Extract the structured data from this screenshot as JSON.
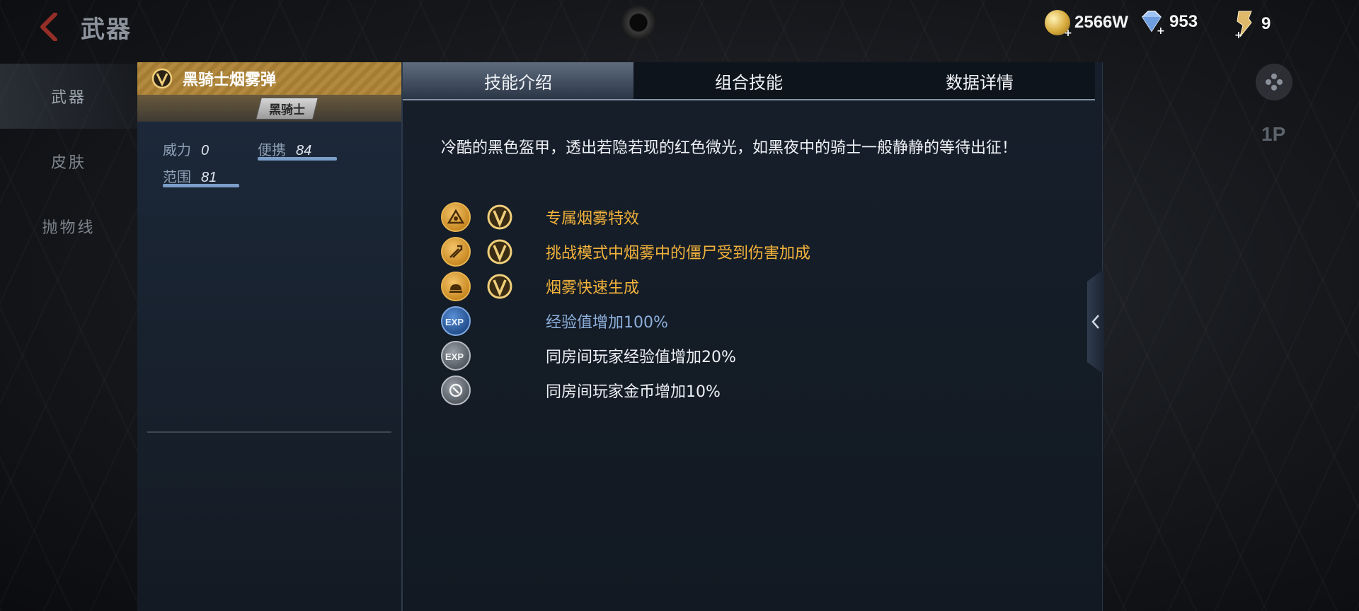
{
  "header": {
    "title": "武器",
    "currencies": [
      {
        "icon": "gold-coin-icon",
        "value": "2566W"
      },
      {
        "icon": "diamond-icon",
        "value": "953"
      },
      {
        "icon": "medal-icon",
        "value": "9"
      }
    ]
  },
  "left_nav": {
    "items": [
      {
        "label": "武器",
        "active": true
      },
      {
        "label": "皮肤",
        "active": false
      },
      {
        "label": "抛物线",
        "active": false
      }
    ]
  },
  "right_controls": {
    "player_label": "1P"
  },
  "item": {
    "name": "黑骑士烟雾弹",
    "series": "黑骑士",
    "stats": [
      {
        "label": "威力",
        "value": "0"
      },
      {
        "label": "便携",
        "value": "84"
      },
      {
        "label": "范围",
        "value": "81"
      }
    ]
  },
  "tabs": [
    {
      "label": "技能介绍",
      "active": true
    },
    {
      "label": "组合技能",
      "active": false
    },
    {
      "label": "数据详情",
      "active": false
    }
  ],
  "description": "冷酷的黑色盔甲，透出若隐若现的红色微光，如黑夜中的骑士一般静静的等待出征！",
  "skills": [
    {
      "text": "专属烟雾特效",
      "icon": "smoke-effect-icon",
      "vip": true,
      "color": "gold"
    },
    {
      "text": "挑战模式中烟雾中的僵尸受到伤害加成",
      "icon": "damage-boost-icon",
      "vip": true,
      "color": "gold"
    },
    {
      "text": "烟雾快速生成",
      "icon": "fast-smoke-icon",
      "vip": true,
      "color": "gold"
    },
    {
      "text": "经验值增加100%",
      "icon": "exp-icon",
      "vip": false,
      "color": "blue"
    },
    {
      "text": "同房间玩家经验值增加20%",
      "icon": "room-exp-icon",
      "vip": false,
      "color": "white"
    },
    {
      "text": "同房间玩家金币增加10%",
      "icon": "room-coin-icon",
      "vip": false,
      "color": "white"
    }
  ],
  "colors": {
    "gold_accent": "#f3b33b",
    "exp_blue": "#8eb0dd",
    "bar_blue": "#7b9ec8"
  }
}
